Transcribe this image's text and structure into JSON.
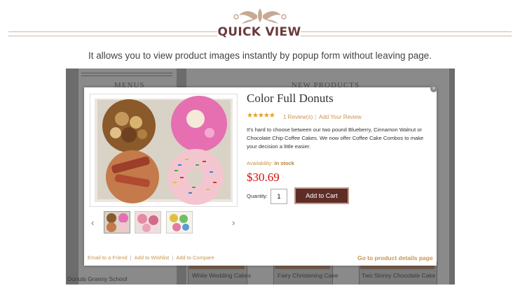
{
  "header": {
    "title": "QUICK VIEW",
    "subtitle": "It allows you to view product images instantly by popup form without leaving page."
  },
  "background_page": {
    "menus_heading": "MENUS",
    "products_heading": "NEW PRODUCTS",
    "sidebar_item": "Donuts Granny School",
    "product_labels": [
      "White Wedding Cakes",
      "Fairy Christening Cake",
      "Two Storey Chocolate Cake"
    ]
  },
  "popup": {
    "close_icon": "×",
    "product_name": "Color Full Donuts",
    "rating": {
      "stars": 5,
      "max": 5,
      "glyphs": "★★★★★"
    },
    "review_count_label": "1 Review(s)",
    "separator": "|",
    "add_review_label": "Add Your Review",
    "description": "It's hard to choose between our two pound Blueberry, Cinnamon Walnut or Chocolate Chip Coffee Cakes. We now offer Coffee Cake Combos to make your decision a little easier.",
    "availability_label": "Availability:",
    "availability_value": "In stock",
    "price": "$30.69",
    "quantity_label": "Quantity:",
    "quantity_value": "1",
    "add_to_cart_label": "Add to Cart",
    "prev_arrow": "‹",
    "next_arrow": "›",
    "footer_links": {
      "email": "Email to a Friend",
      "wishlist": "Add to Wishlist",
      "compare": "Add to Compare",
      "pipe": "|"
    },
    "details_link": "Go to product details page"
  },
  "colors": {
    "accent": "#c8944e",
    "title": "#6b3b3b",
    "price": "#d10e0e",
    "cart_button": "#5e2d25"
  }
}
